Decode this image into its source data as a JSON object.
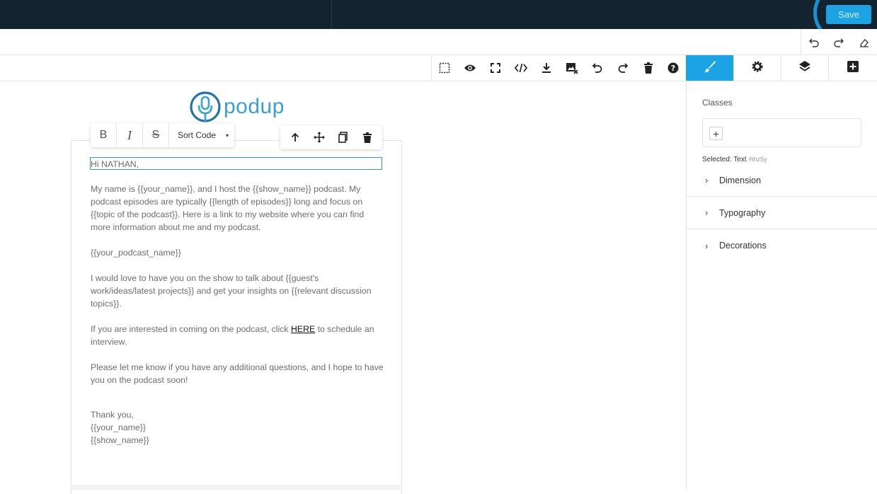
{
  "header": {
    "save_label": "Save"
  },
  "logo": {
    "text": "podup"
  },
  "rte": {
    "bold": "B",
    "italic": "I",
    "strike": "S",
    "sort_label": "Sort Code",
    "sort_caret": "▾"
  },
  "panel": {
    "classes_label": "Classes",
    "add_symbol": "+",
    "selected_prefix": "Selected:",
    "selected_type": "Text",
    "selected_id": "#ihz5y",
    "sections": [
      {
        "label": "Dimension"
      },
      {
        "label": "Typography"
      },
      {
        "label": "Decorations"
      }
    ]
  },
  "email": {
    "greeting": "Hi NATHAN,",
    "p1": "My name is {{your_name}}, and I host the {{show_name}} podcast. My podcast episodes are typically {{length of episodes}} long and focus on {{topic of the podcast}}. Here is a link to my website where you can find more information about me and my podcast.",
    "p2": "{{your_podcast_name}}",
    "p3": "I would love to have you on the show to talk about {{guest's work/ideas/latest projects}} and get your insights on {{relevant discussion topics}}.",
    "p4_before": "If you are interested in coming on the podcast, click ",
    "p4_link": "HERE",
    "p4_after": " to schedule an interview.",
    "p5": "Please let me know if you have any additional questions, and I hope to have you on the podcast soon!",
    "sign_thanks": "Thank you,",
    "sign_name": "{{your_name}}",
    "sign_show": "{{show_name}}"
  },
  "colors": {
    "topbar": "#13232f",
    "accent": "#1ba3e4",
    "logo": "#3aa0cd"
  },
  "icons": {
    "undobar": [
      "undo-icon",
      "redo-icon",
      "eraser-icon"
    ],
    "toolbar": [
      "select-outline-icon",
      "eye-icon",
      "fullscreen-icon",
      "code-icon",
      "download-icon",
      "remove-image-icon",
      "undo-icon",
      "redo-icon",
      "trash-icon",
      "help-icon"
    ],
    "panel_tabs": [
      "brush-icon",
      "gear-icon",
      "layers-icon",
      "add-block-icon"
    ],
    "component": [
      "arrow-up-icon",
      "move-icon",
      "copy-icon",
      "trash-icon"
    ]
  }
}
